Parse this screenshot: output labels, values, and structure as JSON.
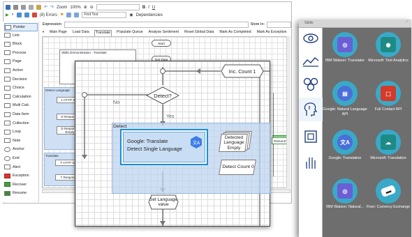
{
  "toolbar": {
    "zoom_label": "Zoom",
    "zoom_value": "100%",
    "errors_label": "(8) Errors",
    "find_label": "Find Text",
    "dependencies_label": "Dependencies",
    "expression_label": "Expression:",
    "store_in_label": "Store In:"
  },
  "palette": [
    "Pointer",
    "Link",
    "Block",
    "Process",
    "Page",
    "Action",
    "Decision",
    "Choice",
    "Calculation",
    "Multi Calc",
    "Data Item",
    "Collection",
    "Loop",
    "Note",
    "Anchor",
    "End",
    "Alert",
    "Exception",
    "Recover",
    "Resume"
  ],
  "tabs": [
    "Main Page",
    "Load Data",
    "Translate",
    "Populate Queue",
    "Analyse Sentiment",
    "Reset Global Data",
    "Mark As Completed",
    "Mark As Exception"
  ],
  "active_tab": "Translate",
  "back_diagram": {
    "start": "Start",
    "get_data": "Get Data",
    "skills_block": "Skills Demonstration - Translate",
    "detect_language_block": "Detect Language",
    "translate_block": "Translate",
    "http_stat": "1 HTTP Stat",
    "d_response": "D Response",
    "d_response_empty": "D Response Empty",
    "t_http_stat": "T HTTP Stat",
    "t_response": "T Response",
    "resume": "Resume?"
  },
  "front_diagram": {
    "inc_count": "Inc. Count 1",
    "detect_question": "Detect?",
    "no_label": "No",
    "yes_label": "Yes",
    "detect_block": "Detect",
    "google_translate_title": "Google: Translate",
    "google_translate_sub": "Detect Single Language",
    "detected_language": "Detected Language Empty",
    "detect_count": "Detect Count 0",
    "set_language": "Set Language value"
  },
  "right_panel": {
    "header": "Skills",
    "cards": [
      {
        "label": "IBM Watson: Translator",
        "icon": "ibm-translator-icon",
        "color": "#6b5fd6"
      },
      {
        "label": "Microsoft: Text Analytics",
        "icon": "text-analytics-icon",
        "color": "#1e8a86"
      },
      {
        "label": "Google: Natural Language API",
        "icon": "google-nl-icon",
        "color": "#4a6fd8"
      },
      {
        "label": "Full Contact API",
        "icon": "fullcontact-icon",
        "color": "#d33a2a"
      },
      {
        "label": "Google: Translation",
        "icon": "google-translation-icon",
        "color": "#4a6fd8"
      },
      {
        "label": "Microsoft: Translation",
        "icon": "ms-translation-icon",
        "color": "#1e8a86"
      },
      {
        "label": "IBM Watson: Natural...",
        "icon": "ibm-natural-icon",
        "color": "#6b5fd6"
      },
      {
        "label": "Fixer: Currency Exchange",
        "icon": "currency-icon",
        "color": "#444444"
      }
    ]
  },
  "colors": {
    "accent": "#3aa9c7",
    "selection": "#1a8fd6",
    "detect_block_bg": "#cfe0f4",
    "panel_bg": "#6e6e6e"
  }
}
